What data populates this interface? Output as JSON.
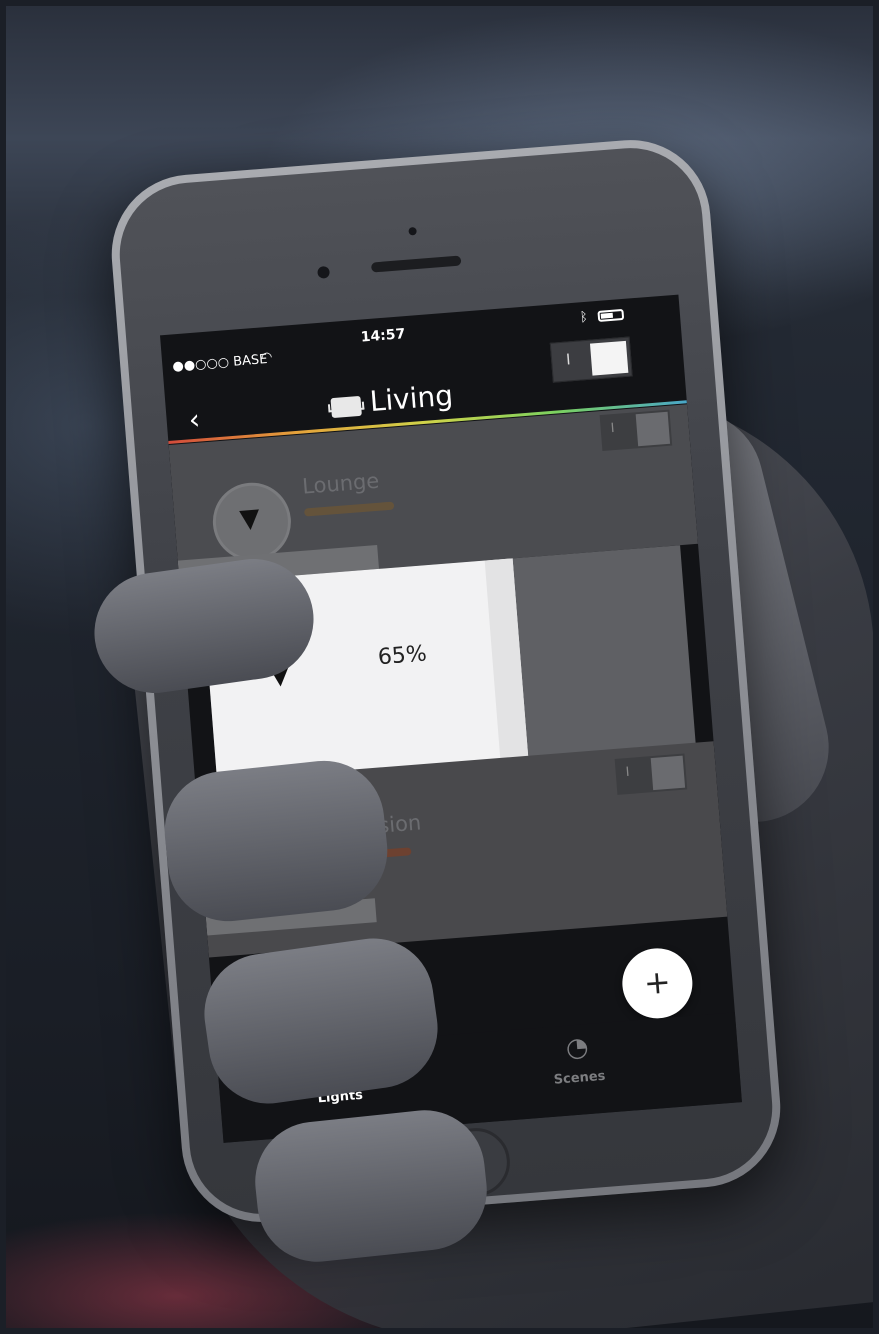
{
  "status_bar": {
    "carrier": "●●○○○ BASE",
    "wifi_icon": "wifi-icon",
    "time": "14:57",
    "bluetooth_icon": "bluetooth-icon",
    "battery_icon": "battery-icon"
  },
  "header": {
    "back_icon": "chevron-left-icon",
    "room_icon": "sofa-icon",
    "title": "Living",
    "master_toggle_mark": "I"
  },
  "lights": [
    {
      "name": "Lounge",
      "toggle_mark": "I",
      "brightness_pct": 40
    },
    {
      "name": "Television",
      "toggle_mark": "I",
      "brightness_pct": 35
    }
  ],
  "dimmer": {
    "value": "65%",
    "fill_fraction": 0.65
  },
  "add_button_label": "+",
  "tabs": [
    {
      "label": "Lights",
      "icon": "bulb-icon",
      "active": true
    },
    {
      "label": "Scenes",
      "icon": "palette-icon",
      "active": false
    }
  ],
  "colors": {
    "accent_bar": [
      "#d24b3b",
      "#e5a33b",
      "#cfd34a",
      "#7bd160",
      "#49a6c8"
    ],
    "screen_bg": "#121316",
    "dimmer_fill": "#f2f2f3"
  }
}
